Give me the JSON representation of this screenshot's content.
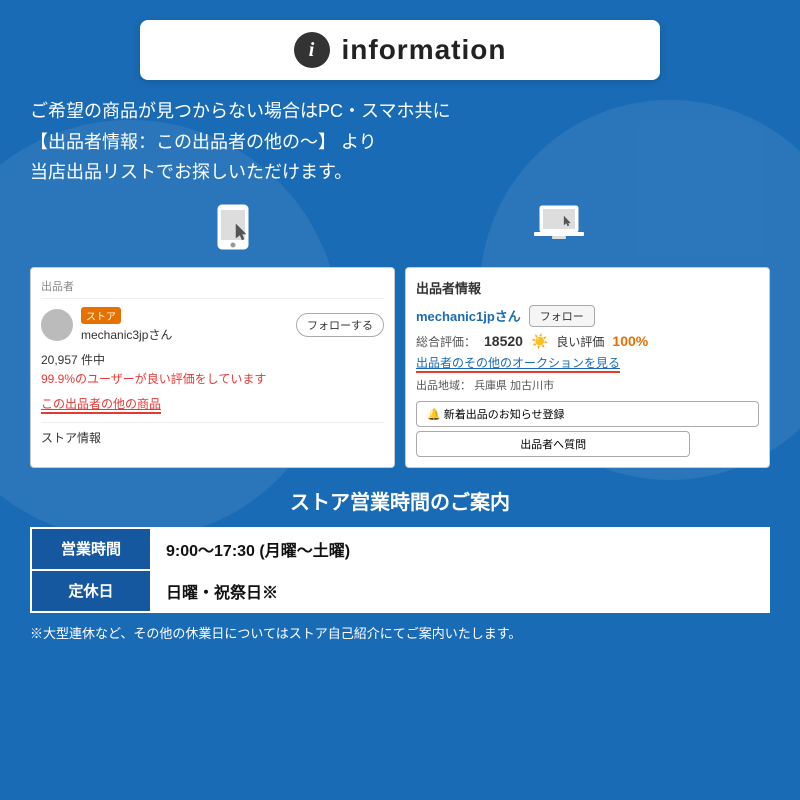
{
  "header": {
    "icon_text": "i",
    "title": "information"
  },
  "main_text": {
    "line1": "ご希望の商品が見つからない場合はPC・スマホ共に",
    "line2": "【出品者情報：この出品者の他の〜】 より",
    "line3": "当店出品リストでお探しいただけます。"
  },
  "left_panel": {
    "label": "出品者",
    "store_badge": "ストア",
    "seller_name": "mechanic3jpさん",
    "follow_btn": "フォローする",
    "stats": "20,957 件中",
    "rating": "99.9%のユーザーが良い評価をしています",
    "other_items": "この出品者の他の商品",
    "store_info": "ストア情報"
  },
  "right_panel": {
    "header": "出品者情報",
    "seller_name": "mechanic1jpさん",
    "follow_btn": "フォロー",
    "rating_label": "総合評価：",
    "rating_num": "18520",
    "good_label": "良い評価",
    "good_pct": "100%",
    "auction_link": "出品者のその他のオークションを見る",
    "location_label": "出品地域：",
    "location_value": "兵庫県 加古川市",
    "notify_btn": "🔔 新着出品のお知らせ登録",
    "question_btn": "出品者へ質問"
  },
  "business": {
    "title": "ストア営業時間のご案内",
    "row1_label": "営業時間",
    "row1_value": "9:00〜17:30 (月曜〜土曜)",
    "row2_label": "定休日",
    "row2_value": "日曜・祝祭日※",
    "footer_note": "※大型連休など、その他の休業日についてはストア自己紹介にてご案内いたします。"
  },
  "icons": {
    "phone": "📱",
    "pc": "💻"
  }
}
